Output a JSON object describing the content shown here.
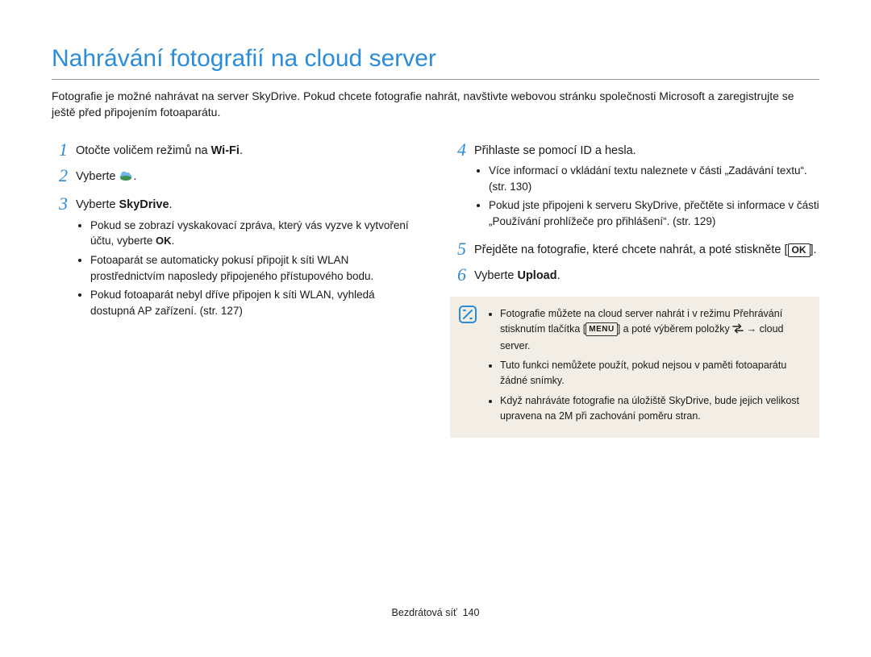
{
  "title": "Nahrávání fotografií na cloud server",
  "intro": "Fotografie je možné nahrávat na server SkyDrive. Pokud chcete fotografie nahrát, navštivte webovou stránku společnosti Microsoft a zaregistrujte se ještě před připojením fotoaparátu.",
  "left": {
    "s1": {
      "num": "1",
      "text_a": "Otočte voličem režimů na ",
      "wifi": "Wi-Fi",
      "text_b": "."
    },
    "s2": {
      "num": "2",
      "text_a": "Vyberte ",
      "text_b": "."
    },
    "s3": {
      "num": "3",
      "text_a": "Vyberte ",
      "bold": "SkyDrive",
      "text_b": ".",
      "b1a": "Pokud se zobrazí vyskakovací zpráva, který vás vyzve k vytvoření účtu, vyberte ",
      "b1ok": "OK",
      "b1b": ".",
      "b2": "Fotoaparát se automaticky pokusí připojit k síti WLAN prostřednictvím naposledy připojeného přístupového bodu.",
      "b3": "Pokud fotoaparát nebyl dříve připojen k síti WLAN, vyhledá dostupná AP zařízení. (str. 127)"
    }
  },
  "right": {
    "s4": {
      "num": "4",
      "text": "Přihlaste se pomocí ID a hesla.",
      "b1": "Více informací o vkládání textu naleznete v části „Zadávání textu“. (str. 130)",
      "b2": "Pokud jste připojeni k serveru SkyDrive, přečtěte si informace v části „Používání prohlížeče pro přihlášení“. (str. 129)"
    },
    "s5": {
      "num": "5",
      "text_a": "Přejděte na fotografie, které chcete nahrát, a poté stiskněte [",
      "ok": "OK",
      "text_b": "]."
    },
    "s6": {
      "num": "6",
      "text_a": "Vyberte ",
      "bold": "Upload",
      "text_b": "."
    },
    "note": {
      "n1a": "Fotografie můžete na cloud server nahrát i v režimu Přehrávání stisknutím tlačítka [",
      "menu": "MENU",
      "n1b": "] a poté výběrem položky ",
      "n1c": " → cloud server.",
      "n2": "Tuto funkci nemůžete použít, pokud nejsou v paměti fotoaparátu žádné snímky.",
      "n3": "Když nahráváte fotografie na úložiště SkyDrive, bude jejich velikost upravena na 2M při zachování poměru stran."
    }
  },
  "footer": {
    "section": "Bezdrátová síť",
    "page": "140"
  }
}
